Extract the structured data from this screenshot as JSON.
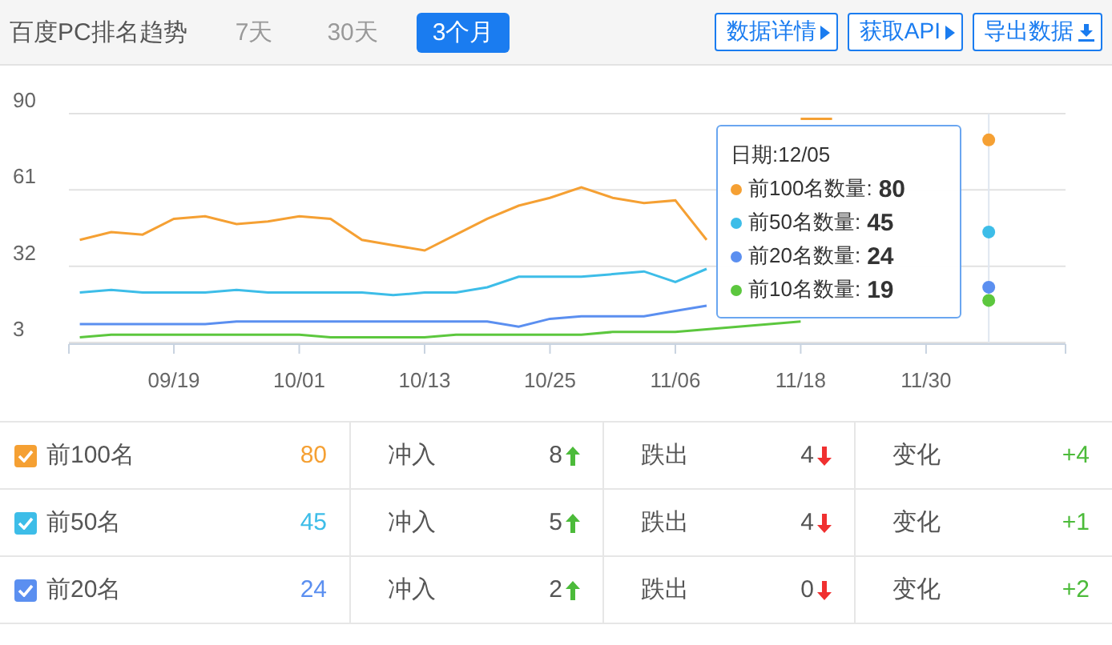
{
  "header": {
    "title": "百度PC排名趋势",
    "tabs": [
      {
        "label": "7天",
        "selected": false
      },
      {
        "label": "30天",
        "selected": false
      },
      {
        "label": "3个月",
        "selected": true
      }
    ],
    "buttons": [
      {
        "label": "数据详情",
        "kind": "arrow"
      },
      {
        "label": "获取API",
        "kind": "arrow"
      },
      {
        "label": "导出数据",
        "kind": "download"
      }
    ]
  },
  "chart": {
    "chart_data": {
      "type": "line",
      "categories": [
        null,
        null,
        null,
        "09/19",
        null,
        null,
        null,
        "10/01",
        null,
        null,
        null,
        "10/13",
        null,
        null,
        null,
        "10/25",
        null,
        null,
        null,
        "11/06",
        null,
        null,
        null,
        "11/18",
        null,
        null,
        null,
        "11/30",
        null,
        null
      ],
      "ylim": [
        3,
        90
      ],
      "yticks": [
        3,
        32,
        61,
        90
      ],
      "series": [
        {
          "name": "前100名数量",
          "color": "#f5a033",
          "values": [
            42,
            45,
            44,
            50,
            51,
            48,
            49,
            51,
            50,
            42,
            40,
            38,
            44,
            50,
            55,
            58,
            62,
            58,
            56,
            57,
            42,
            null,
            null,
            88,
            88,
            null,
            null,
            null,
            null,
            80
          ]
        },
        {
          "name": "前50名数量",
          "color": "#3dbde8",
          "values": [
            22,
            23,
            22,
            22,
            22,
            23,
            22,
            22,
            22,
            22,
            21,
            22,
            22,
            24,
            28,
            28,
            28,
            29,
            30,
            26,
            31,
            null,
            null,
            null,
            null,
            null,
            null,
            null,
            null,
            45
          ]
        },
        {
          "name": "前20名数量",
          "color": "#5b8ff0",
          "values": [
            10,
            10,
            10,
            10,
            10,
            11,
            11,
            11,
            11,
            11,
            11,
            11,
            11,
            11,
            9,
            12,
            13,
            13,
            13,
            15,
            17,
            null,
            null,
            null,
            null,
            null,
            null,
            null,
            null,
            24
          ]
        },
        {
          "name": "前10名数量",
          "color": "#5cc73e",
          "values": [
            5,
            6,
            6,
            6,
            6,
            6,
            6,
            6,
            5,
            5,
            5,
            5,
            6,
            6,
            6,
            6,
            6,
            7,
            7,
            7,
            8,
            9,
            10,
            11,
            null,
            null,
            null,
            null,
            null,
            19
          ]
        }
      ]
    },
    "tooltip": {
      "date": "日期:12/05",
      "separator": ":",
      "rows": [
        {
          "value": "80"
        },
        {
          "value": "45"
        },
        {
          "value": "24"
        },
        {
          "value": "19"
        }
      ]
    }
  },
  "table": {
    "rows": [
      {
        "label": "前100名",
        "checked": true,
        "color": "#f5a033",
        "count": "80",
        "in_label": "冲入",
        "in": "8",
        "out_label": "跌出",
        "out": "4",
        "change_label": "变化",
        "change": "+4"
      },
      {
        "label": "前50名",
        "checked": true,
        "color": "#3dbde8",
        "count": "45",
        "in_label": "冲入",
        "in": "5",
        "out_label": "跌出",
        "out": "4",
        "change_label": "变化",
        "change": "+1"
      },
      {
        "label": "前20名",
        "checked": true,
        "color": "#5b8ff0",
        "count": "24",
        "in_label": "冲入",
        "in": "2",
        "out_label": "跌出",
        "out": "0",
        "change_label": "变化",
        "change": "+2"
      }
    ]
  }
}
